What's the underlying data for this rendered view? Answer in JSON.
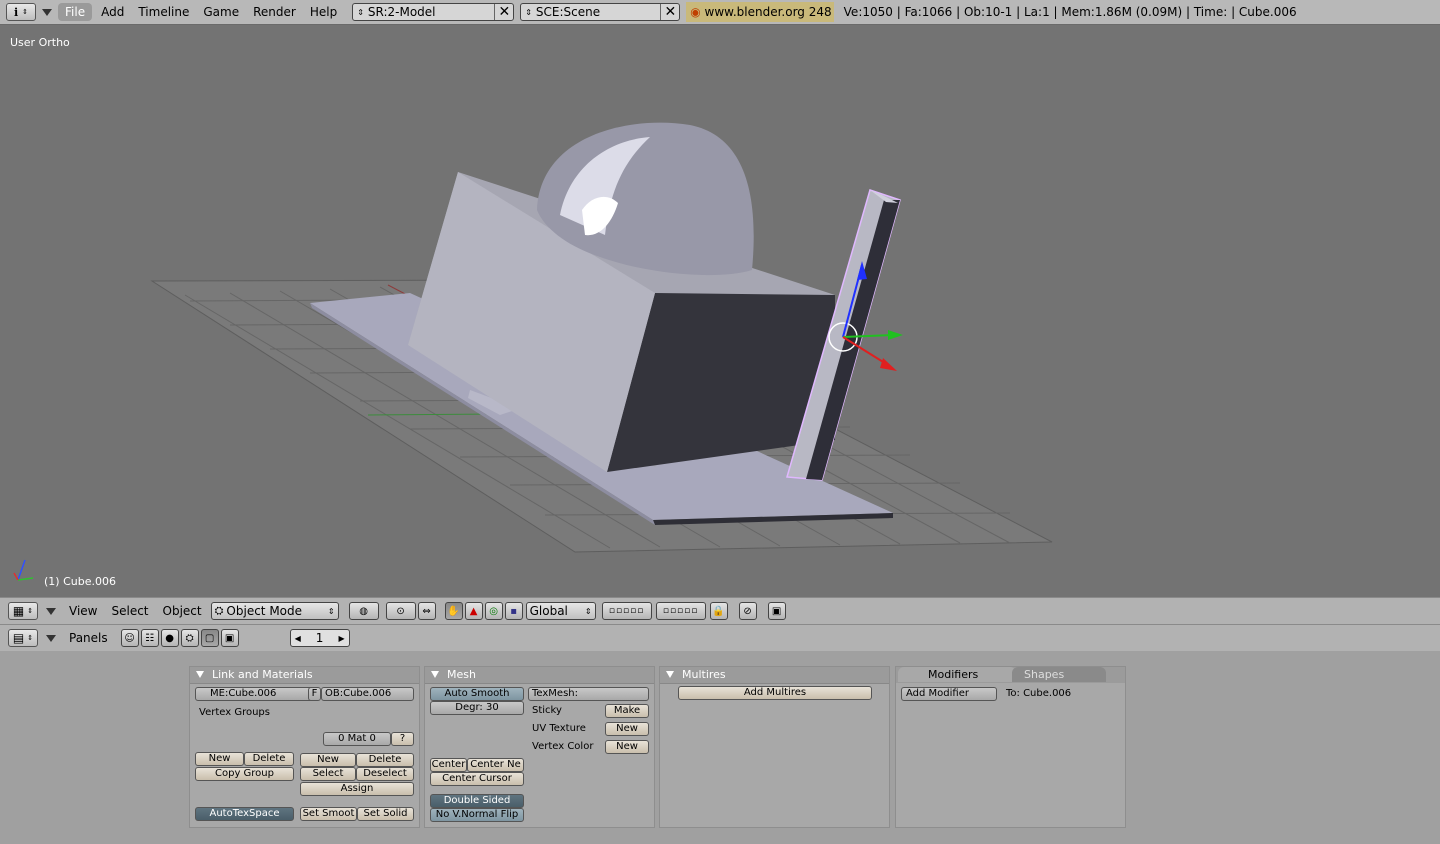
{
  "top": {
    "menus": [
      "File",
      "Add",
      "Timeline",
      "Game",
      "Render",
      "Help"
    ],
    "active_menu": "File",
    "screen": "SR:2-Model",
    "scene": "SCE:Scene",
    "site": "www.blender.org 248",
    "stats": "Ve:1050 | Fa:1066 | Ob:10-1 | La:1  | Mem:1.86M (0.09M)  | Time: | Cube.006"
  },
  "viewport": {
    "view_label": "User Ortho",
    "object_label": "(1) Cube.006"
  },
  "view3d_header": {
    "menus": [
      "View",
      "Select",
      "Object"
    ],
    "mode": "Object Mode",
    "orientation": "Global"
  },
  "buttons_header": {
    "panels_label": "Panels",
    "frame": "1"
  },
  "panels": {
    "link": {
      "title": "Link and Materials",
      "me": "ME:Cube.006",
      "f": "F",
      "ob": "OB:Cube.006",
      "vertex_groups": "Vertex Groups",
      "mat": "0 Mat 0",
      "q": "?",
      "new": "New",
      "delete": "Delete",
      "copy_group": "Copy Group",
      "new2": "New",
      "delete2": "Delete",
      "select": "Select",
      "deselect": "Deselect",
      "assign": "Assign",
      "autotex": "AutoTexSpace",
      "set_smooth": "Set Smoot",
      "set_solid": "Set Solid"
    },
    "mesh": {
      "title": "Mesh",
      "auto_smooth": "Auto Smooth",
      "degr": "Degr: 30",
      "texmesh": "TexMesh:",
      "sticky": "Sticky",
      "make": "Make",
      "uv_texture": "UV Texture",
      "new_uv": "New",
      "vertex_color": "Vertex Color",
      "new_vc": "New",
      "center": "Center",
      "center_new": "Center Ne",
      "center_cursor": "Center Cursor",
      "double_sided": "Double Sided",
      "no_vnormal": "No V.Normal Flip"
    },
    "multires": {
      "title": "Multires",
      "add": "Add Multires"
    },
    "modifiers": {
      "tab_modifiers": "Modifiers",
      "tab_shapes": "Shapes",
      "add": "Add Modifier",
      "to": "To: Cube.006"
    }
  }
}
